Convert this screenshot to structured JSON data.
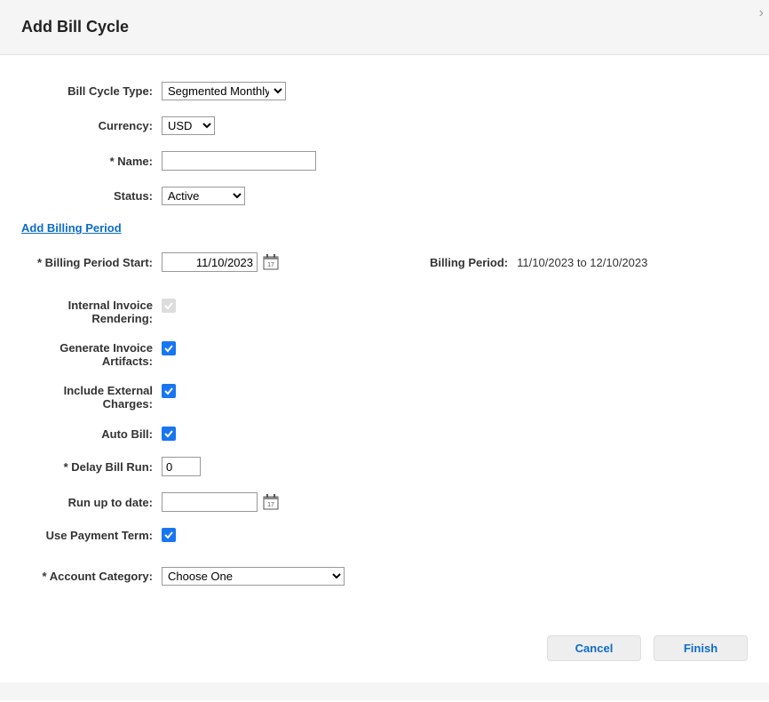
{
  "header": {
    "title": "Add Bill Cycle"
  },
  "labels": {
    "billCycleType": "Bill Cycle Type:",
    "currency": "Currency:",
    "name": "* Name:",
    "status": "Status:",
    "addBillingPeriod": "Add Billing Period",
    "billingPeriodStart": "* Billing Period Start:",
    "billingPeriod": "Billing Period:",
    "internalInvoiceRendering": "Internal Invoice Rendering:",
    "generateInvoiceArtifacts": "Generate Invoice Artifacts:",
    "includeExternalCharges": "Include External Charges:",
    "autoBill": "Auto Bill:",
    "delayBillRun": "* Delay Bill Run:",
    "runUpToDate": "Run up to date:",
    "usePaymentTerm": "Use Payment Term:",
    "accountCategory": "* Account Category:"
  },
  "values": {
    "billCycleType": "Segmented Monthly",
    "currency": "USD",
    "name": "",
    "status": "Active",
    "billingPeriodStart": "11/10/2023",
    "billingPeriodText": "11/10/2023 to 12/10/2023",
    "delayBillRun": "0",
    "runUpToDate": "",
    "accountCategory": "Choose One"
  },
  "buttons": {
    "cancel": "Cancel",
    "finish": "Finish"
  }
}
